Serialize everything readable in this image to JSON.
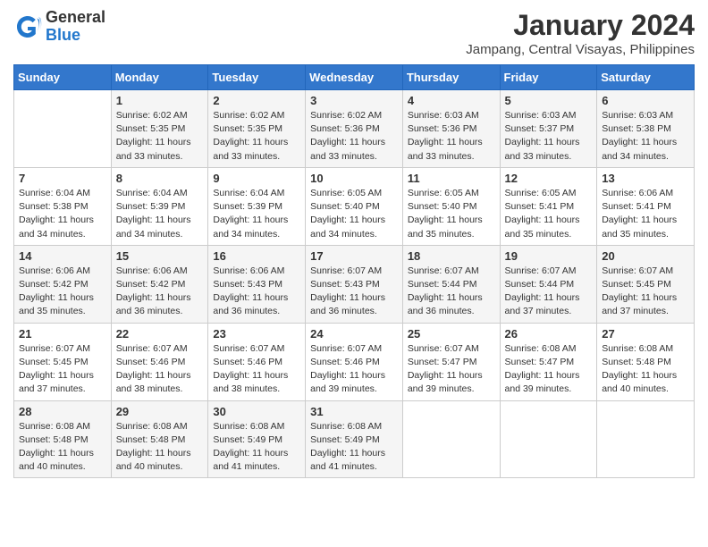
{
  "logo": {
    "general": "General",
    "blue": "Blue"
  },
  "header": {
    "month": "January 2024",
    "location": "Jampang, Central Visayas, Philippines"
  },
  "weekdays": [
    "Sunday",
    "Monday",
    "Tuesday",
    "Wednesday",
    "Thursday",
    "Friday",
    "Saturday"
  ],
  "weeks": [
    [
      {
        "day": "",
        "sunrise": "",
        "sunset": "",
        "daylight": ""
      },
      {
        "day": "1",
        "sunrise": "Sunrise: 6:02 AM",
        "sunset": "Sunset: 5:35 PM",
        "daylight": "Daylight: 11 hours and 33 minutes."
      },
      {
        "day": "2",
        "sunrise": "Sunrise: 6:02 AM",
        "sunset": "Sunset: 5:35 PM",
        "daylight": "Daylight: 11 hours and 33 minutes."
      },
      {
        "day": "3",
        "sunrise": "Sunrise: 6:02 AM",
        "sunset": "Sunset: 5:36 PM",
        "daylight": "Daylight: 11 hours and 33 minutes."
      },
      {
        "day": "4",
        "sunrise": "Sunrise: 6:03 AM",
        "sunset": "Sunset: 5:36 PM",
        "daylight": "Daylight: 11 hours and 33 minutes."
      },
      {
        "day": "5",
        "sunrise": "Sunrise: 6:03 AM",
        "sunset": "Sunset: 5:37 PM",
        "daylight": "Daylight: 11 hours and 33 minutes."
      },
      {
        "day": "6",
        "sunrise": "Sunrise: 6:03 AM",
        "sunset": "Sunset: 5:38 PM",
        "daylight": "Daylight: 11 hours and 34 minutes."
      }
    ],
    [
      {
        "day": "7",
        "sunrise": "Sunrise: 6:04 AM",
        "sunset": "Sunset: 5:38 PM",
        "daylight": "Daylight: 11 hours and 34 minutes."
      },
      {
        "day": "8",
        "sunrise": "Sunrise: 6:04 AM",
        "sunset": "Sunset: 5:39 PM",
        "daylight": "Daylight: 11 hours and 34 minutes."
      },
      {
        "day": "9",
        "sunrise": "Sunrise: 6:04 AM",
        "sunset": "Sunset: 5:39 PM",
        "daylight": "Daylight: 11 hours and 34 minutes."
      },
      {
        "day": "10",
        "sunrise": "Sunrise: 6:05 AM",
        "sunset": "Sunset: 5:40 PM",
        "daylight": "Daylight: 11 hours and 34 minutes."
      },
      {
        "day": "11",
        "sunrise": "Sunrise: 6:05 AM",
        "sunset": "Sunset: 5:40 PM",
        "daylight": "Daylight: 11 hours and 35 minutes."
      },
      {
        "day": "12",
        "sunrise": "Sunrise: 6:05 AM",
        "sunset": "Sunset: 5:41 PM",
        "daylight": "Daylight: 11 hours and 35 minutes."
      },
      {
        "day": "13",
        "sunrise": "Sunrise: 6:06 AM",
        "sunset": "Sunset: 5:41 PM",
        "daylight": "Daylight: 11 hours and 35 minutes."
      }
    ],
    [
      {
        "day": "14",
        "sunrise": "Sunrise: 6:06 AM",
        "sunset": "Sunset: 5:42 PM",
        "daylight": "Daylight: 11 hours and 35 minutes."
      },
      {
        "day": "15",
        "sunrise": "Sunrise: 6:06 AM",
        "sunset": "Sunset: 5:42 PM",
        "daylight": "Daylight: 11 hours and 36 minutes."
      },
      {
        "day": "16",
        "sunrise": "Sunrise: 6:06 AM",
        "sunset": "Sunset: 5:43 PM",
        "daylight": "Daylight: 11 hours and 36 minutes."
      },
      {
        "day": "17",
        "sunrise": "Sunrise: 6:07 AM",
        "sunset": "Sunset: 5:43 PM",
        "daylight": "Daylight: 11 hours and 36 minutes."
      },
      {
        "day": "18",
        "sunrise": "Sunrise: 6:07 AM",
        "sunset": "Sunset: 5:44 PM",
        "daylight": "Daylight: 11 hours and 36 minutes."
      },
      {
        "day": "19",
        "sunrise": "Sunrise: 6:07 AM",
        "sunset": "Sunset: 5:44 PM",
        "daylight": "Daylight: 11 hours and 37 minutes."
      },
      {
        "day": "20",
        "sunrise": "Sunrise: 6:07 AM",
        "sunset": "Sunset: 5:45 PM",
        "daylight": "Daylight: 11 hours and 37 minutes."
      }
    ],
    [
      {
        "day": "21",
        "sunrise": "Sunrise: 6:07 AM",
        "sunset": "Sunset: 5:45 PM",
        "daylight": "Daylight: 11 hours and 37 minutes."
      },
      {
        "day": "22",
        "sunrise": "Sunrise: 6:07 AM",
        "sunset": "Sunset: 5:46 PM",
        "daylight": "Daylight: 11 hours and 38 minutes."
      },
      {
        "day": "23",
        "sunrise": "Sunrise: 6:07 AM",
        "sunset": "Sunset: 5:46 PM",
        "daylight": "Daylight: 11 hours and 38 minutes."
      },
      {
        "day": "24",
        "sunrise": "Sunrise: 6:07 AM",
        "sunset": "Sunset: 5:46 PM",
        "daylight": "Daylight: 11 hours and 39 minutes."
      },
      {
        "day": "25",
        "sunrise": "Sunrise: 6:07 AM",
        "sunset": "Sunset: 5:47 PM",
        "daylight": "Daylight: 11 hours and 39 minutes."
      },
      {
        "day": "26",
        "sunrise": "Sunrise: 6:08 AM",
        "sunset": "Sunset: 5:47 PM",
        "daylight": "Daylight: 11 hours and 39 minutes."
      },
      {
        "day": "27",
        "sunrise": "Sunrise: 6:08 AM",
        "sunset": "Sunset: 5:48 PM",
        "daylight": "Daylight: 11 hours and 40 minutes."
      }
    ],
    [
      {
        "day": "28",
        "sunrise": "Sunrise: 6:08 AM",
        "sunset": "Sunset: 5:48 PM",
        "daylight": "Daylight: 11 hours and 40 minutes."
      },
      {
        "day": "29",
        "sunrise": "Sunrise: 6:08 AM",
        "sunset": "Sunset: 5:48 PM",
        "daylight": "Daylight: 11 hours and 40 minutes."
      },
      {
        "day": "30",
        "sunrise": "Sunrise: 6:08 AM",
        "sunset": "Sunset: 5:49 PM",
        "daylight": "Daylight: 11 hours and 41 minutes."
      },
      {
        "day": "31",
        "sunrise": "Sunrise: 6:08 AM",
        "sunset": "Sunset: 5:49 PM",
        "daylight": "Daylight: 11 hours and 41 minutes."
      },
      {
        "day": "",
        "sunrise": "",
        "sunset": "",
        "daylight": ""
      },
      {
        "day": "",
        "sunrise": "",
        "sunset": "",
        "daylight": ""
      },
      {
        "day": "",
        "sunrise": "",
        "sunset": "",
        "daylight": ""
      }
    ]
  ]
}
